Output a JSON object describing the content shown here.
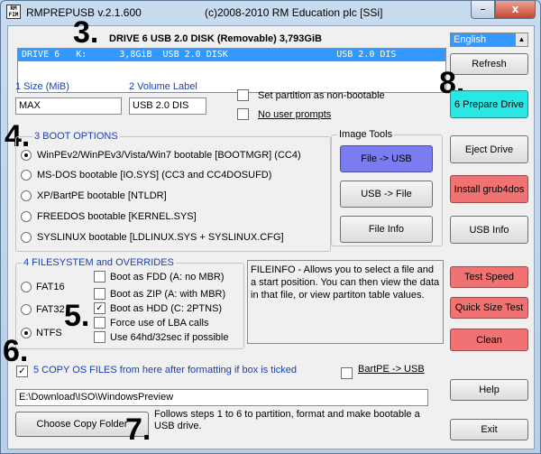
{
  "window": {
    "title": "RMPREPUSB v.2.1.600",
    "copyright": "(c)2008-2010 RM Education plc [SSi]",
    "minimize_glyph": "–",
    "close_glyph": "x",
    "icon_text_1": "RM",
    "icon_text_2": "FIM"
  },
  "header": {
    "drive_title": "DRIVE 6 USB 2.0 DISK  (Removable) 3,793GiB",
    "language": "English",
    "language_arrow": "▲"
  },
  "drive_list": {
    "rows": [
      "DRIVE 6   K:      3,8GiB  USB 2.0 DISK                    USB 2.0 DIS"
    ]
  },
  "size": {
    "label": "1 Size (MiB)",
    "value": "MAX"
  },
  "volume": {
    "label": "2 Volume Label",
    "value": "USB 2.0 DIS"
  },
  "options": {
    "non_bootable": "Set partition as non-bootable",
    "no_prompts": "No user prompts"
  },
  "boot_options": {
    "title": "3 BOOT OPTIONS",
    "items": [
      "WinPEv2/WinPEv3/Vista/Win7 bootable [BOOTMGR] (CC4)",
      "MS-DOS bootable [IO.SYS]    (CC3 and CC4DOSUFD)",
      "XP/BartPE bootable [NTLDR]",
      "FREEDOS bootable [KERNEL.SYS]",
      "SYSLINUX bootable [LDLINUX.SYS + SYSLINUX.CFG]"
    ],
    "selected_index": 0
  },
  "image_tools": {
    "title": "Image Tools",
    "file_to_usb": "File -> USB",
    "usb_to_file": "USB -> File",
    "file_info": "File Info"
  },
  "filesystem": {
    "title": "4 FILESYSTEM and OVERRIDES",
    "fs": [
      "FAT16",
      "FAT32",
      "NTFS"
    ],
    "selected_fs": "NTFS",
    "overrides": [
      {
        "label": "Boot as FDD (A: no MBR)",
        "checked": false
      },
      {
        "label": "Boot as ZIP (A: with MBR)",
        "checked": false
      },
      {
        "label": "Boot as HDD (C: 2PTNS)",
        "checked": true
      },
      {
        "label": "Force use of LBA calls",
        "checked": false
      },
      {
        "label": "Use 64hd/32sec if possible",
        "checked": false
      }
    ]
  },
  "info_text": "FILEINFO - Allows you to select a file and a start position. You can then view the data in that file, or view partiton table values.",
  "copy_files": {
    "label": "5 COPY OS FILES from here after formatting if box is ticked",
    "checked": true,
    "path": "E:\\Download\\ISO\\WindowsPreview",
    "bartpe": "BartPE -> USB",
    "choose": "Choose Copy Folder",
    "help_text": "Follows steps 1 to 6 to partition, format and make bootable a USB drive."
  },
  "right_buttons": {
    "refresh": "Refresh",
    "prepare": "6 Prepare Drive",
    "eject": "Eject Drive",
    "grub": "Install grub4dos",
    "usb_info": "USB Info",
    "test_speed": "Test Speed",
    "quick_size": "Quick Size Test",
    "clean": "Clean",
    "help": "Help",
    "exit": "Exit"
  },
  "step_markers": [
    "3.",
    "8.",
    "4.",
    "5.",
    "6.",
    "7."
  ],
  "check_mark": "✓",
  "colors": {
    "accent_blue": "#1a3fb0",
    "selection": "#3399ff",
    "red_button": "#f07272",
    "cyan_button": "#29e8e4",
    "purple_button": "#7b7bf2"
  }
}
